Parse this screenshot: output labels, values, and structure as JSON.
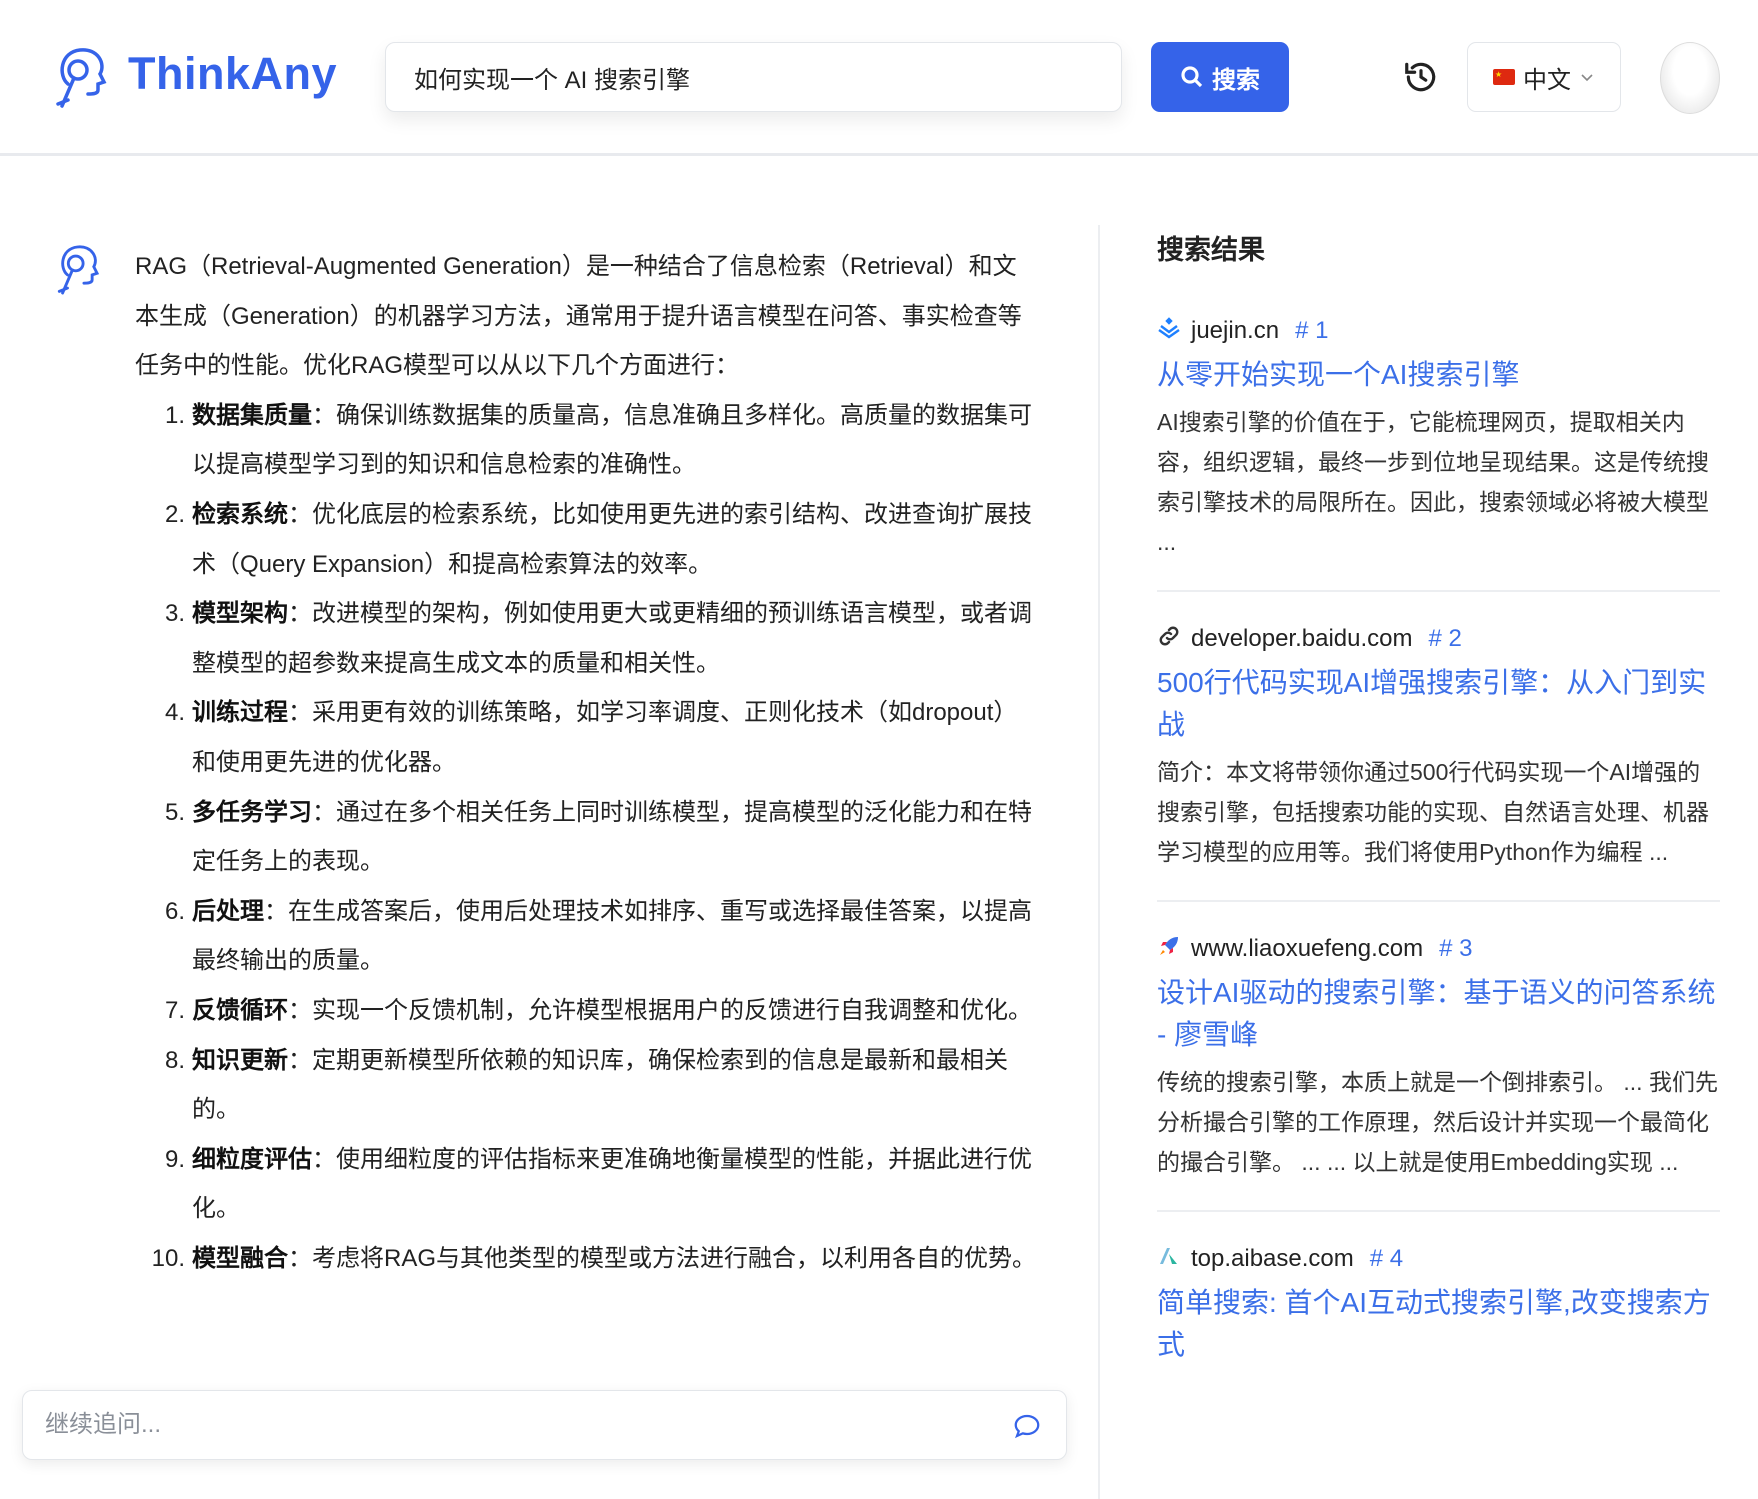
{
  "header": {
    "brand": "ThinkAny",
    "search_value": "如何实现一个 AI 搜索引擎",
    "search_button": "搜索",
    "language": "中文"
  },
  "answer": {
    "intro": "RAG（Retrieval-Augmented Generation）是一种结合了信息检索（Retrieval）和文本生成（Generation）的机器学习方法，通常用于提升语言模型在问答、事实检查等任务中的性能。优化RAG模型可以从以下几个方面进行：",
    "items": [
      {
        "num": "1.",
        "title": "数据集质量",
        "text": "：确保训练数据集的质量高，信息准确且多样化。高质量的数据集可以提高模型学习到的知识和信息检索的准确性。"
      },
      {
        "num": "2.",
        "title": "检索系统",
        "text": "：优化底层的检索系统，比如使用更先进的索引结构、改进查询扩展技术（Query Expansion）和提高检索算法的效率。"
      },
      {
        "num": "3.",
        "title": "模型架构",
        "text": "：改进模型的架构，例如使用更大或更精细的预训练语言模型，或者调整模型的超参数来提高生成文本的质量和相关性。"
      },
      {
        "num": "4.",
        "title": "训练过程",
        "text": "：采用更有效的训练策略，如学习率调度、正则化技术（如dropout）和使用更先进的优化器。"
      },
      {
        "num": "5.",
        "title": "多任务学习",
        "text": "：通过在多个相关任务上同时训练模型，提高模型的泛化能力和在特定任务上的表现。"
      },
      {
        "num": "6.",
        "title": "后处理",
        "text": "：在生成答案后，使用后处理技术如排序、重写或选择最佳答案，以提高最终输出的质量。"
      },
      {
        "num": "7.",
        "title": "反馈循环",
        "text": "：实现一个反馈机制，允许模型根据用户的反馈进行自我调整和优化。"
      },
      {
        "num": "8.",
        "title": "知识更新",
        "text": "：定期更新模型所依赖的知识库，确保检索到的信息是最新和最相关的。"
      },
      {
        "num": "9.",
        "title": "细粒度评估",
        "text": "：使用细粒度的评估指标来更准确地衡量模型的性能，并据此进行优化。"
      },
      {
        "num": "10.",
        "title": "模型融合",
        "text": "：考虑将RAG与其他类型的模型或方法进行融合，以利用各自的优势。"
      }
    ]
  },
  "followup": {
    "placeholder": "继续追问..."
  },
  "results": {
    "title": "搜索结果",
    "items": [
      {
        "domain": "juejin.cn",
        "rank": "# 1",
        "icon": "juejin-icon",
        "icon_color": "#1e80ff",
        "title": "从零开始实现一个AI搜索引擎",
        "snippet": "AI搜索引擎的价值在于，它能梳理网页，提取相关内容，组织逻辑，最终一步到位地呈现结果。这是传统搜索引擎技术的局限所在。因此，搜索领域必将被大模型 ..."
      },
      {
        "domain": "developer.baidu.com",
        "rank": "# 2",
        "icon": "link-icon",
        "icon_color": "#333333",
        "title": "500行代码实现AI增强搜索引擎：从入门到实战",
        "snippet": "简介：本文将带领你通过500行代码实现一个AI增强的搜索引擎，包括搜索功能的实现、自然语言处理、机器学习模型的应用等。我们将使用Python作为编程 ..."
      },
      {
        "domain": "www.liaoxuefeng.com",
        "rank": "# 3",
        "icon": "rocket-icon",
        "icon_color": "#3b6fe8",
        "title": "设计AI驱动的搜索引擎：基于语义的问答系统 - 廖雪峰",
        "snippet": "传统的搜索引擎，本质上就是一个倒排索引。 ... 我们先分析撮合引擎的工作原理，然后设计并实现一个最简化的撮合引擎。 ... ... 以上就是使用Embedding实现 ..."
      },
      {
        "domain": "top.aibase.com",
        "rank": "# 4",
        "icon": "aibase-icon",
        "icon_color": "#2bb5a0",
        "title": "简单搜索: 首个AI互动式搜索引擎,改变搜索方式",
        "snippet": ""
      }
    ]
  },
  "colors": {
    "brand": "#3563e9",
    "link": "#3b6fe8"
  }
}
